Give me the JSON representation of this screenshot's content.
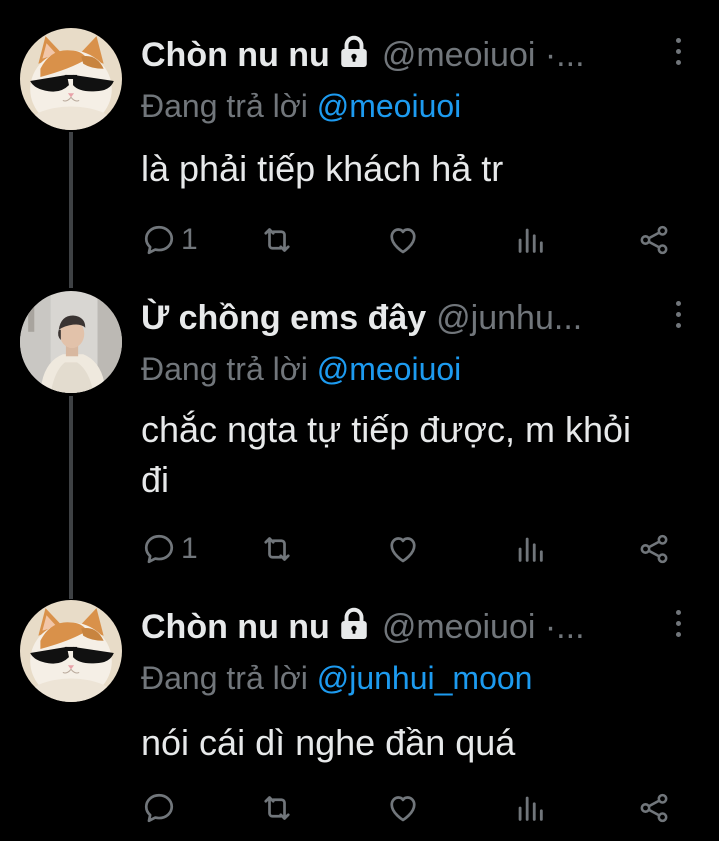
{
  "colors": {
    "background": "#000000",
    "text": "#e7e9ea",
    "muted": "#71767b",
    "accent": "#1d9bf0"
  },
  "tweets": [
    {
      "name": "Chòn nu nu",
      "locked": true,
      "handle": "@meoiuoi ·...",
      "reply_prefix": "Đang trả lời",
      "reply_to": "@meoiuoi",
      "text": "là phải tiếp khách hả tr",
      "reply_count": "1",
      "avatar": "cat-sunglasses"
    },
    {
      "name": "Ừ chồng ems đây",
      "locked": false,
      "handle": "@junhu...",
      "reply_prefix": "Đang trả lời",
      "reply_to": "@meoiuoi",
      "text": "chắc ngta tự tiếp được, m khỏi đi",
      "reply_count": "1",
      "avatar": "person-photo"
    },
    {
      "name": "Chòn nu nu",
      "locked": true,
      "handle": "@meoiuoi ·...",
      "reply_prefix": "Đang trả lời",
      "reply_to": "@junhui_moon",
      "text": "nói cái dì nghe đần quá",
      "reply_count": "",
      "avatar": "cat-sunglasses"
    }
  ],
  "action_icons": [
    "reply-icon",
    "retweet-icon",
    "like-icon",
    "views-icon",
    "share-icon"
  ]
}
